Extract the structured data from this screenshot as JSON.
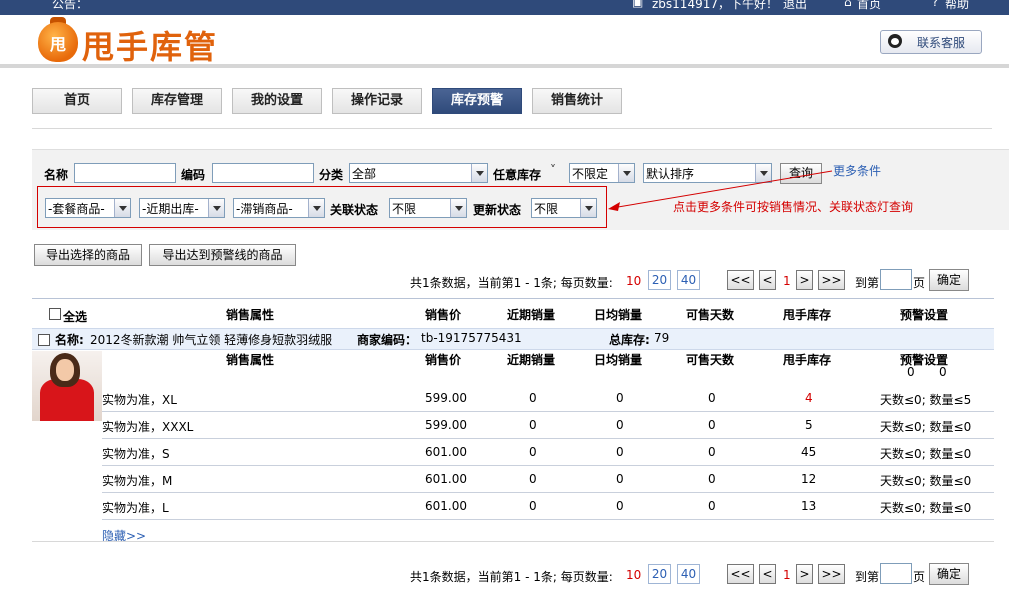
{
  "topbar": {
    "announcement": "公告：",
    "user_greeting": "zbs114917，下午好！",
    "logout": "退出",
    "home": "首页",
    "help": "帮助"
  },
  "header": {
    "logo_char": "甩",
    "logo_text": "甩手库管",
    "service_label": "联系客服"
  },
  "tabs": [
    {
      "label": "首页"
    },
    {
      "label": "库存管理"
    },
    {
      "label": "我的设置"
    },
    {
      "label": "操作记录"
    },
    {
      "label": "库存预警",
      "active": true
    },
    {
      "label": "销售统计"
    }
  ],
  "search": {
    "name_label": "名称",
    "code_label": "编码",
    "category_label": "分类",
    "category_value": "全部",
    "stock_label": "任意库存",
    "stock_value": "不限定",
    "sort_value": "默认排序",
    "query_button": "查询",
    "more_link": "更多条件",
    "package_value": "-套餐商品-",
    "recent_out_value": "-近期出库-",
    "slow_value": "-滞销商品-",
    "link_status_label": "关联状态",
    "link_status_value": "不限",
    "update_status_label": "更新状态",
    "update_status_value": "不限",
    "hint_text": "点击更多条件可按销售情况、关联状态灯查询"
  },
  "actions": {
    "export_selected": "导出选择的商品",
    "export_warning": "导出达到预警线的商品"
  },
  "pagination": {
    "summary": "共1条数据，当前第1 - 1条; 每页数量:",
    "sizes": [
      "10",
      "20",
      "40"
    ],
    "first": "<<",
    "prev": "<",
    "current": "1",
    "next": ">",
    "last": ">>",
    "goto_prefix": "到第",
    "goto_suffix": "页",
    "confirm": "确定"
  },
  "table": {
    "select_all": "全选",
    "headers": [
      "销售属性",
      "销售价",
      "近期销量",
      "日均销量",
      "可售天数",
      "甩手库存",
      "预警设置"
    ],
    "product": {
      "name_label": "名称:",
      "name": "2012冬新款潮 帅气立领 轻薄修身短款羽绒服",
      "code_label": "商家编码：",
      "code": "tb-19175775431",
      "total_label": "总库存:",
      "total": "79",
      "warning_days": "0",
      "warning_qty": "0"
    },
    "rows": [
      {
        "attr": "实物为准，XL",
        "price": "599.00",
        "recent": "0",
        "daily": "0",
        "days": "0",
        "stock": "4",
        "warn": "天数≤0; 数量≤5",
        "stock_red": true
      },
      {
        "attr": "实物为准，XXXL",
        "price": "599.00",
        "recent": "0",
        "daily": "0",
        "days": "0",
        "stock": "5",
        "warn": "天数≤0; 数量≤0"
      },
      {
        "attr": "实物为准，S",
        "price": "601.00",
        "recent": "0",
        "daily": "0",
        "days": "0",
        "stock": "45",
        "warn": "天数≤0; 数量≤0"
      },
      {
        "attr": "实物为准，M",
        "price": "601.00",
        "recent": "0",
        "daily": "0",
        "days": "0",
        "stock": "12",
        "warn": "天数≤0; 数量≤0"
      },
      {
        "attr": "实物为准，L",
        "price": "601.00",
        "recent": "0",
        "daily": "0",
        "days": "0",
        "stock": "13",
        "warn": "天数≤0; 数量≤0"
      }
    ],
    "hide_link": "隐藏>>"
  },
  "colors": {
    "brand_orange": "#e0620c",
    "nav_blue": "#2f4a7a",
    "alert_red": "#d40000",
    "link_blue": "#2c5fb3"
  }
}
